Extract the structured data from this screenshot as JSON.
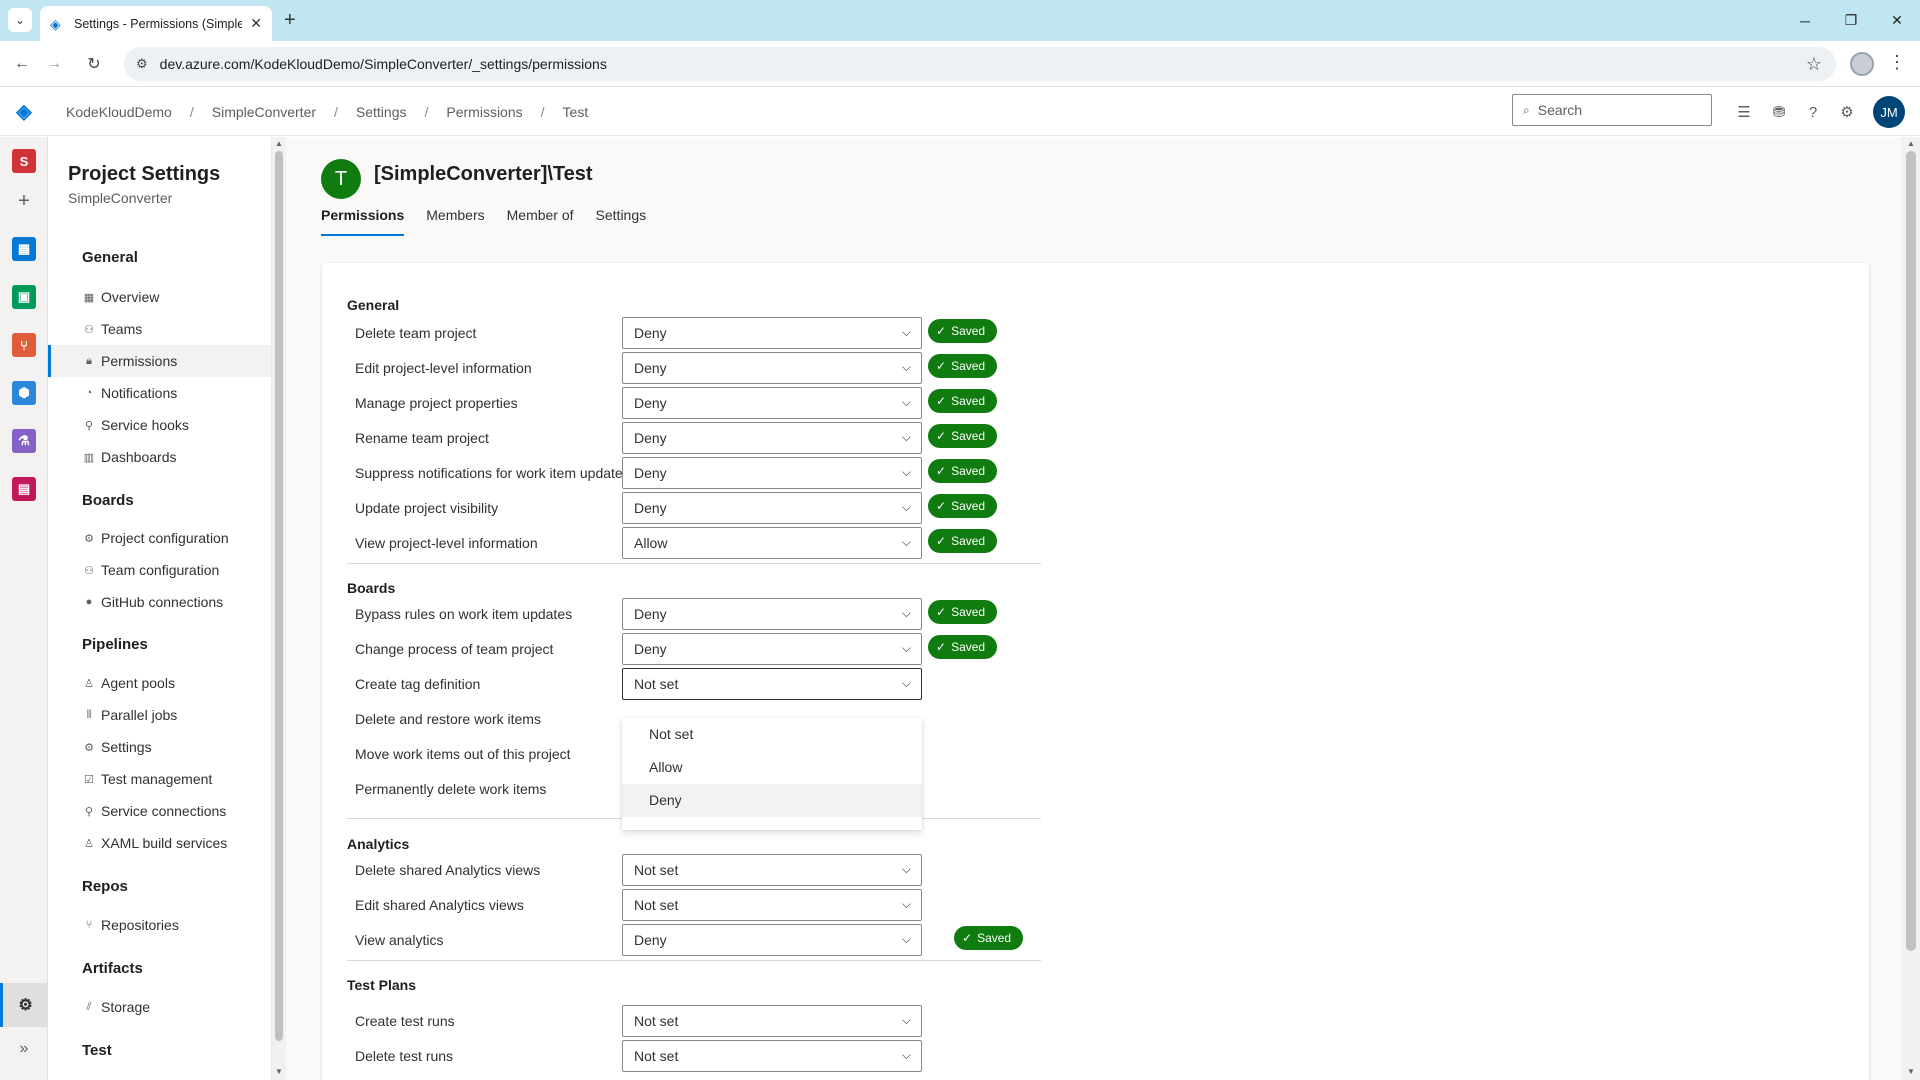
{
  "browser": {
    "tab_title": "Settings - Permissions (SimpleC",
    "url": "dev.azure.com/KodeKloudDemo/SimpleConverter/_settings/permissions"
  },
  "header": {
    "breadcrumb": [
      "KodeKloudDemo",
      "SimpleConverter",
      "Settings",
      "Permissions",
      "Test"
    ],
    "search_placeholder": "Search",
    "user_initials": "JM"
  },
  "rail": {
    "project_initial": "S"
  },
  "settings_nav": {
    "title": "Project Settings",
    "subtitle": "SimpleConverter",
    "groups": [
      {
        "label": "General",
        "items": [
          "Overview",
          "Teams",
          "Permissions",
          "Notifications",
          "Service hooks",
          "Dashboards"
        ]
      },
      {
        "label": "Boards",
        "items": [
          "Project configuration",
          "Team configuration",
          "GitHub connections"
        ]
      },
      {
        "label": "Pipelines",
        "items": [
          "Agent pools",
          "Parallel jobs",
          "Settings",
          "Test management",
          "Service connections",
          "XAML build services"
        ]
      },
      {
        "label": "Repos",
        "items": [
          "Repositories"
        ]
      },
      {
        "label": "Artifacts",
        "items": [
          "Storage"
        ]
      },
      {
        "label": "Test",
        "items": []
      }
    ]
  },
  "main": {
    "group_initial": "T",
    "group_title": "[SimpleConverter]\\Test",
    "tabs": [
      "Permissions",
      "Members",
      "Member of",
      "Settings"
    ],
    "saved_label": "Saved",
    "sections": [
      {
        "title": "General",
        "rows": [
          {
            "label": "Delete team project",
            "value": "Deny",
            "saved": true
          },
          {
            "label": "Edit project-level information",
            "value": "Deny",
            "saved": true
          },
          {
            "label": "Manage project properties",
            "value": "Deny",
            "saved": true
          },
          {
            "label": "Rename team project",
            "value": "Deny",
            "saved": true
          },
          {
            "label": "Suppress notifications for work item updates",
            "value": "Deny",
            "saved": true
          },
          {
            "label": "Update project visibility",
            "value": "Deny",
            "saved": true
          },
          {
            "label": "View project-level information",
            "value": "Allow",
            "saved": true
          }
        ]
      },
      {
        "title": "Boards",
        "rows": [
          {
            "label": "Bypass rules on work item updates",
            "value": "Deny",
            "saved": true
          },
          {
            "label": "Change process of team project",
            "value": "Deny",
            "saved": true
          },
          {
            "label": "Create tag definition",
            "value": "Not set",
            "saved": false
          },
          {
            "label": "Delete and restore work items",
            "value": "",
            "saved": false
          },
          {
            "label": "Move work items out of this project",
            "value": "",
            "saved": false
          },
          {
            "label": "Permanently delete work items",
            "value": "",
            "saved": false
          }
        ]
      },
      {
        "title": "Analytics",
        "rows": [
          {
            "label": "Delete shared Analytics views",
            "value": "Not set",
            "saved": false
          },
          {
            "label": "Edit shared Analytics views",
            "value": "Not set",
            "saved": false
          },
          {
            "label": "View analytics",
            "value": "Deny",
            "saved": true
          }
        ]
      },
      {
        "title": "Test Plans",
        "rows": [
          {
            "label": "Create test runs",
            "value": "Not set",
            "saved": false
          },
          {
            "label": "Delete test runs",
            "value": "Not set",
            "saved": false
          }
        ]
      }
    ],
    "dropdown_options": [
      "Not set",
      "Allow",
      "Deny"
    ]
  }
}
